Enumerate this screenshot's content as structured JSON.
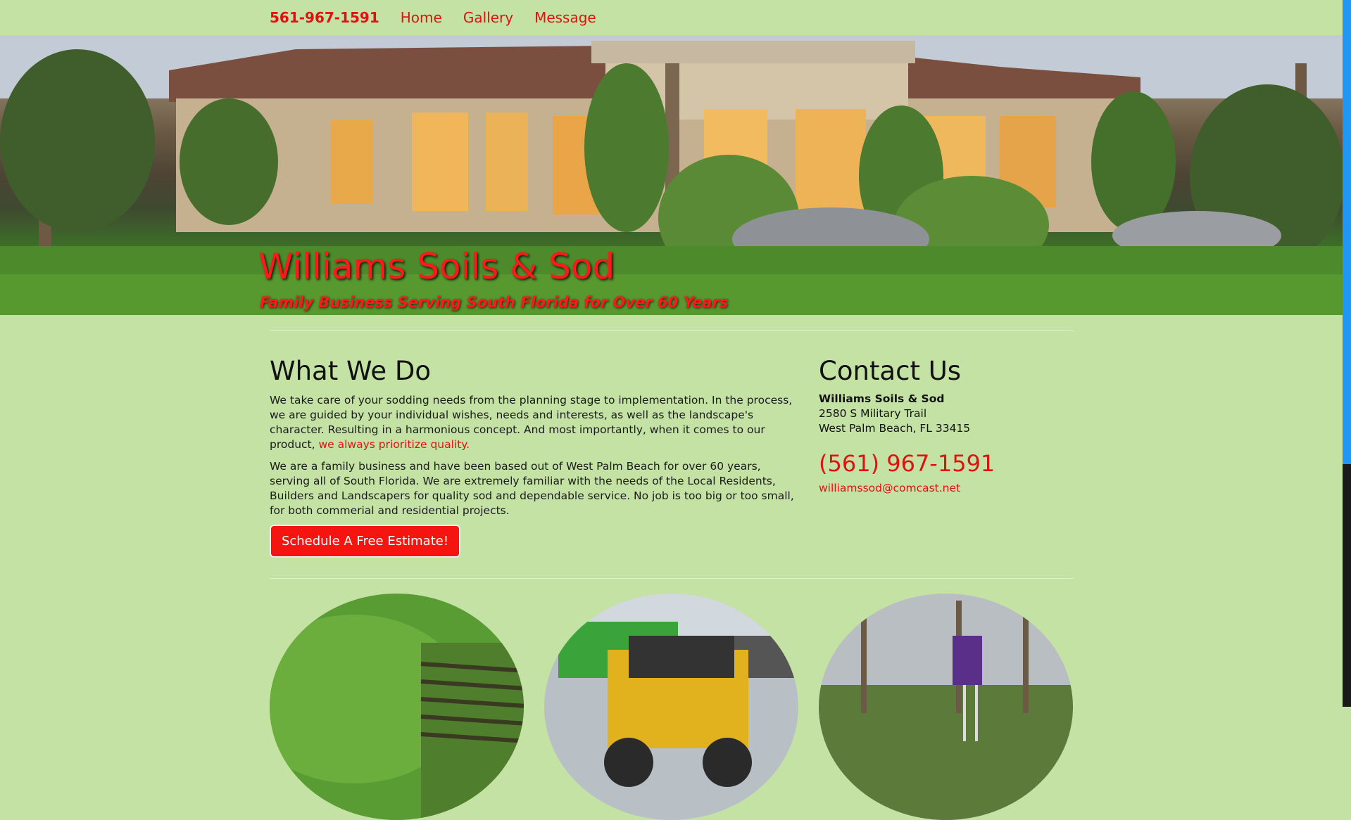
{
  "nav": {
    "phone": "561-967-1591",
    "links": [
      "Home",
      "Gallery",
      "Message"
    ]
  },
  "hero": {
    "title": "Williams Soils & Sod",
    "subtitle": "Family Business Serving South Florida for Over 60 Years"
  },
  "what_we_do": {
    "heading": "What We Do",
    "para1_lead": "We take care of your sodding needs from the planning stage to implementation. In the process, we are guided by your individual wishes, needs and interests, as well as the landscape's character. Resulting in a harmonious concept. And most importantly, when it comes to our product, ",
    "para1_accent": "we always prioritize quality.",
    "para2": "We are a family business and have been based out of West Palm Beach for over 60 years, serving all of South Florida. We are extremely familiar with the needs of the Local Residents, Builders and Landscapers for quality sod and dependable service. No job is too big or too small, for both commerial and residential projects.",
    "button": "Schedule A Free Estimate!"
  },
  "contact": {
    "heading": "Contact Us",
    "name": "Williams Soils & Sod",
    "street": "2580 S Military Trail",
    "city": "West Palm Beach, FL 33415",
    "phone": "(561) 967-1591",
    "email": "williamssod@comcast.net"
  },
  "colors": {
    "page_bg": "#c4e2a4",
    "accent": "#e31010",
    "button_bg": "#f5140f"
  }
}
